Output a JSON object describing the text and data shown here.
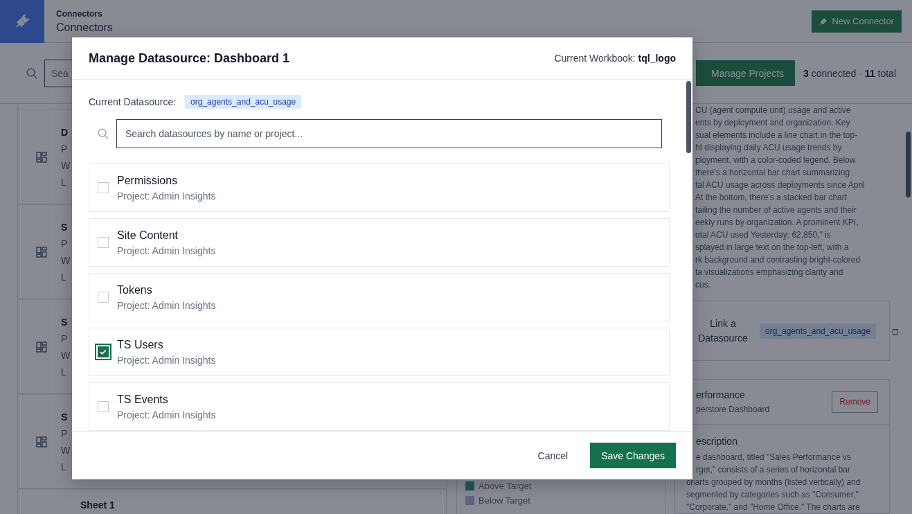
{
  "header": {
    "breadcrumb": "Connectors",
    "title": "Connectors",
    "new_button": "New Connector"
  },
  "toolbar": {
    "search_placeholder": "Sea",
    "manage_button": "Manage Projects",
    "connected_count": "3",
    "connected_label": "connected",
    "separator": "·",
    "total_count": "11",
    "total_label": "total"
  },
  "items": [
    {
      "title": "D",
      "lines": [
        "P",
        "W",
        "L"
      ]
    },
    {
      "title": "S",
      "lines": [
        "P",
        "W",
        "L"
      ]
    },
    {
      "title": "S",
      "lines": [
        "P",
        "W",
        "L"
      ]
    },
    {
      "title": "S",
      "lines": [
        "P",
        "W",
        "L"
      ]
    },
    {
      "title": "Sheet 1"
    }
  ],
  "legend": [
    {
      "label": "Above Target",
      "color": "#1c4e5a"
    },
    {
      "label": "Below Target",
      "color": "#60607f"
    }
  ],
  "right_panel": {
    "description_lines": [
      "CU (agent compute unit) usage and active",
      "ents by deployment and organization. Key",
      "sual elements include a line chart in the top-",
      "ht displaying daily ACU usage trends by",
      "ployment, with a color-coded legend. Below",
      "there's a horizontal bar chart summarizing",
      "tal ACU usage across deployments since April",
      "At the bottom, there's a stacked bar chart",
      "tailing the number of active agents and their",
      "eekly runs by organization. A prominent KPI,",
      "otal ACU used Yesterday: 62,850,\" is",
      "splayed in large text on the top-left, with a",
      "rk background and contrasting bright-colored",
      "ta visualizations emphasizing clarity and",
      "cus."
    ],
    "link_card": {
      "label": "Link a Datasource",
      "chip": "org_agents_and_acu_usage"
    },
    "dashboard_card": {
      "title": "erformance",
      "subtitle": "perstore Dashboard",
      "remove_button": "Remove",
      "description_heading": "escription",
      "description_cut_lines": [
        "e dashboard, titled \"Sales Performance vs",
        "rget,\" consists of a series of horizontal bar"
      ],
      "description_lines": [
        "charts grouped by months (listed vertically) and",
        "segmented by categories such as \"Consumer,\"",
        "\"Corporate,\" and \"Home Office.\" The charts are"
      ]
    }
  },
  "modal": {
    "title": "Manage Datasource: Dashboard 1",
    "workbook_label": "Current Workbook:",
    "workbook_name": "tql_logo",
    "current_label": "Current Datasource:",
    "current_chip": "org_agents_and_acu_usage",
    "search_placeholder": "Search datasources by name or project...",
    "datasources": [
      {
        "name": "Permissions",
        "project": "Project: Admin Insights",
        "checked": false
      },
      {
        "name": "Site Content",
        "project": "Project: Admin Insights",
        "checked": false
      },
      {
        "name": "Tokens",
        "project": "Project: Admin Insights",
        "checked": false
      },
      {
        "name": "TS Users",
        "project": "Project: Admin Insights",
        "checked": true
      },
      {
        "name": "TS Events",
        "project": "Project: Admin Insights",
        "checked": false
      }
    ],
    "cancel": "Cancel",
    "save": "Save Changes"
  }
}
